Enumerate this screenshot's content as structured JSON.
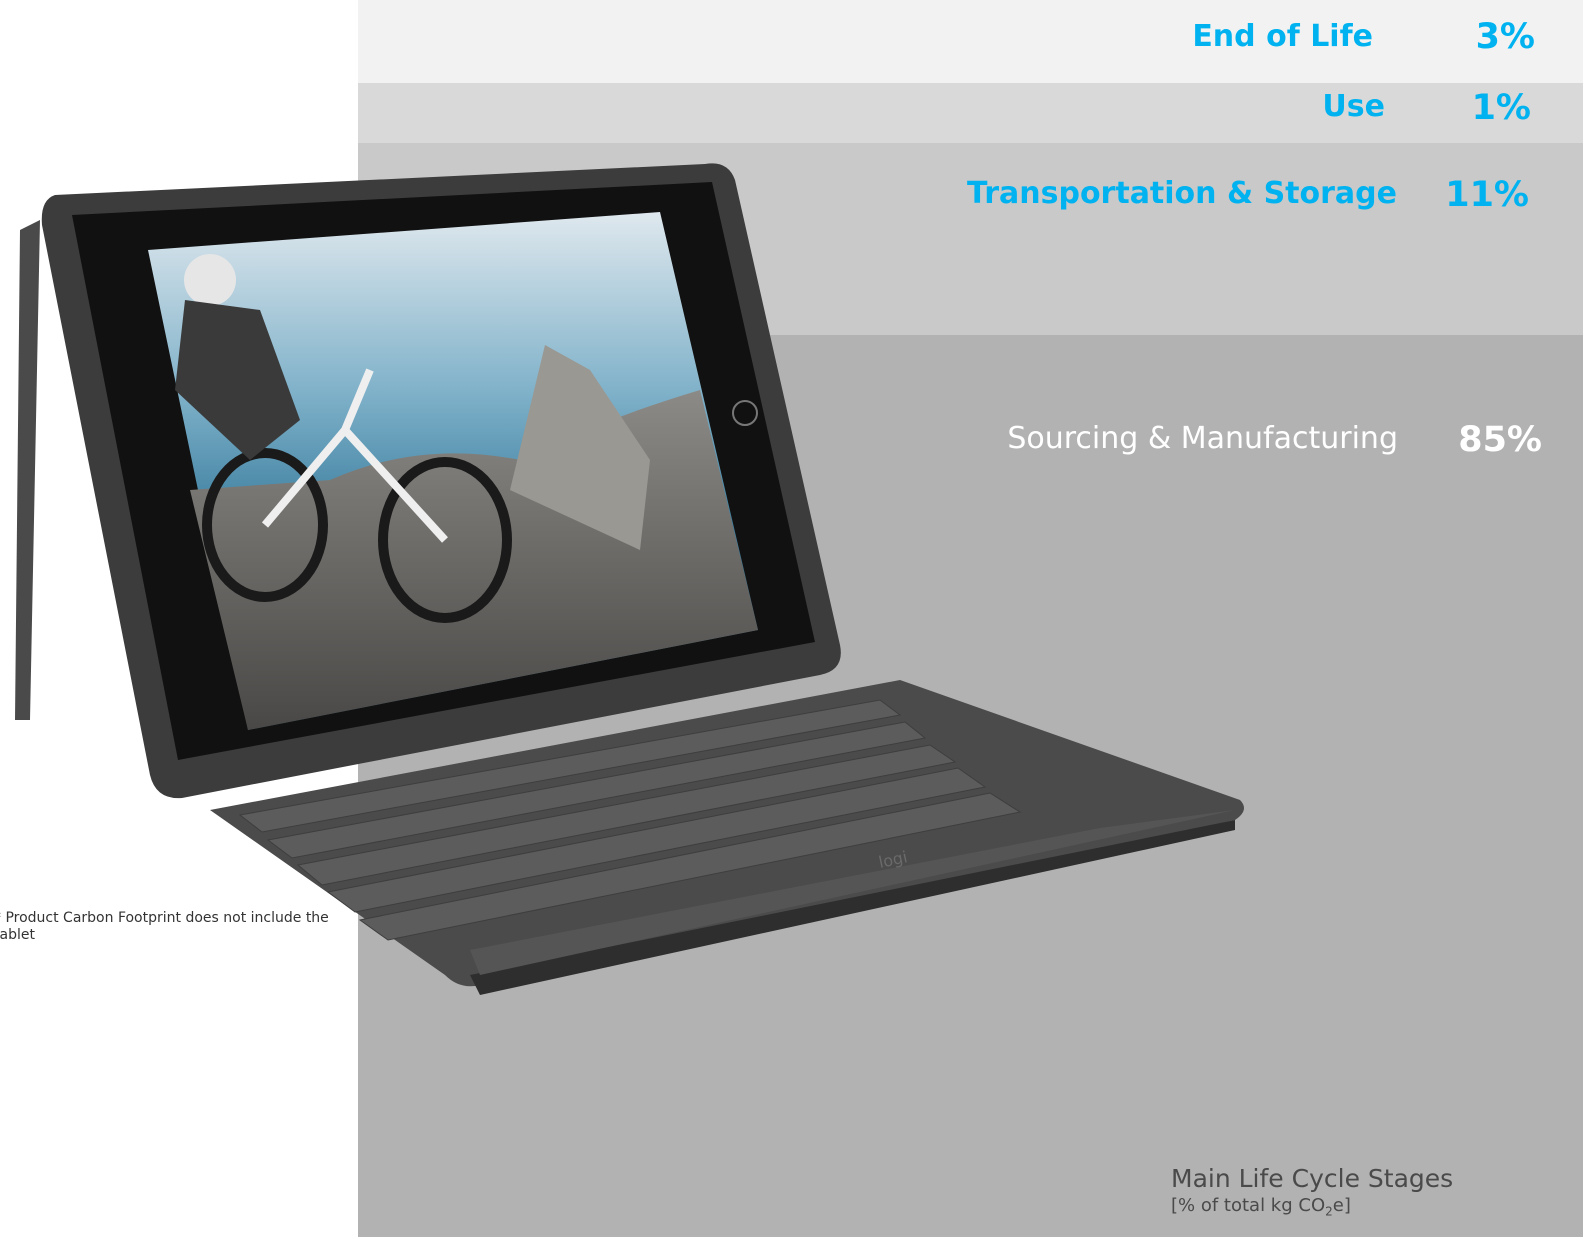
{
  "chart_data": {
    "type": "bar",
    "title": "Main Life Cycle Stages",
    "unit_label_prefix": "[% of total kg CO",
    "unit_label_sub": "2",
    "unit_label_suffix": "e]",
    "categories": [
      "End of Life",
      "Use",
      "Transportation & Storage",
      "Sourcing & Manufacturing"
    ],
    "values": [
      3,
      1,
      11,
      85
    ],
    "value_labels": [
      "3%",
      "1%",
      "11%",
      "85%"
    ],
    "colors": {
      "accent_text": "#00b3f0",
      "white_text": "#ffffff",
      "band_end_of_life": "#f2f2f2",
      "band_use": "#d9d9d9",
      "band_transportation": "#c9c9c9",
      "band_sourcing": "#b2b2b2"
    }
  },
  "footnote": "* Product Carbon Footprint does not include the tablet",
  "product_image": {
    "name": "tablet-keyboard-case",
    "keyboard_logo": "logi"
  }
}
